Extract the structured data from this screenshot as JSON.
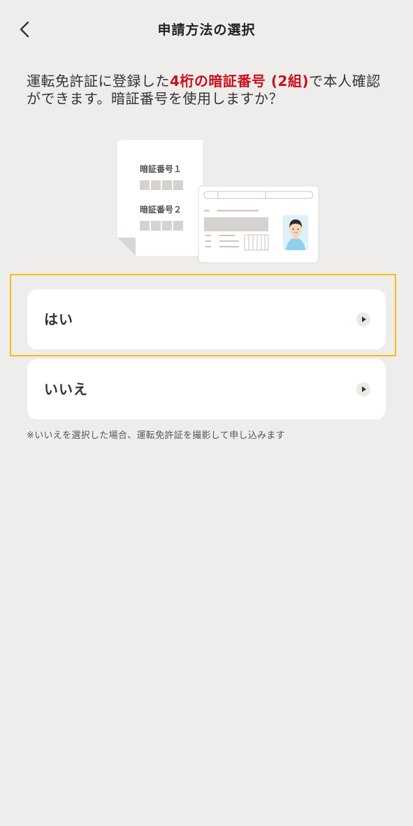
{
  "header": {
    "title": "申請方法の選択",
    "back_icon": "chevron-left-icon"
  },
  "intro": {
    "text_before": "運転免許証に登録した",
    "text_highlight": "4桁の暗証番号 (2組)",
    "text_after": "で本人確認ができます。暗証番号を使用しますか？"
  },
  "illustration": {
    "pin1_label": "暗証番号１",
    "pin2_label": "暗証番号２"
  },
  "options": [
    {
      "label": "はい",
      "icon": "play-arrow-icon"
    },
    {
      "label": "いいえ",
      "icon": "play-arrow-icon"
    }
  ],
  "note": "※いいえを選択した場合、運転免許証を撮影して申し込みます",
  "colors": {
    "background": "#efedeb",
    "accent_red": "#c8101e",
    "highlight_frame": "#f6bf0e"
  }
}
